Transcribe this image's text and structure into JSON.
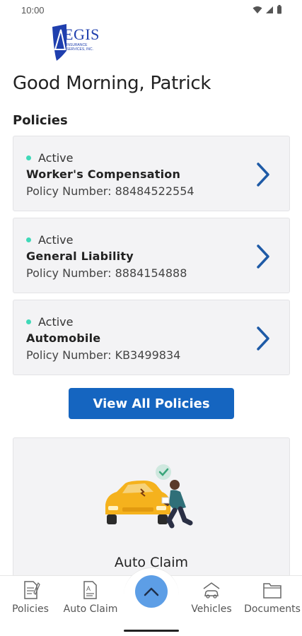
{
  "status_bar": {
    "time": "10:00"
  },
  "logo": {
    "brand": "AEGIS",
    "subtitle": "INSURANCE SERVICES, INC."
  },
  "greeting": "Good Morning, Patrick",
  "policies_title": "Policies",
  "policies": [
    {
      "status": "Active",
      "name": "Worker's Compensation",
      "number": "Policy Number: 88484522554"
    },
    {
      "status": "Active",
      "name": "General Liability",
      "number": "Policy Number: 8884154888"
    },
    {
      "status": "Active",
      "name": "Automobile",
      "number": "Policy Number: KB3499834"
    }
  ],
  "view_all_label": "View All Policies",
  "claim_card": {
    "title": "Auto Claim"
  },
  "bottom_nav": {
    "items": [
      {
        "label": "Policies",
        "icon": "policies-icon"
      },
      {
        "label": "Auto Claim",
        "icon": "auto-claim-icon"
      },
      {
        "label": "Vehicles",
        "icon": "vehicles-icon"
      },
      {
        "label": "Documents",
        "icon": "documents-icon"
      }
    ],
    "fab_icon": "chevron-up-icon"
  },
  "colors": {
    "primary": "#1565c0",
    "active_dot": "#3fd9b8",
    "chevron": "#1e5aa6",
    "fab": "#5d9ee6",
    "card_bg": "#f3f3f5"
  }
}
